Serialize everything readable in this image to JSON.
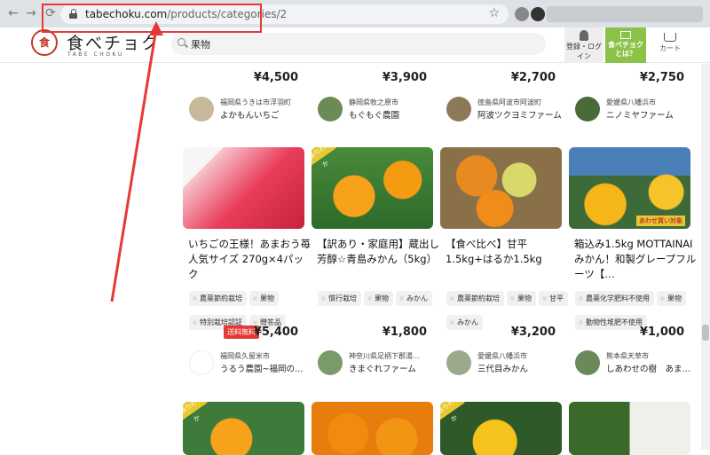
{
  "browser": {
    "url_domain": "tabechoku.com",
    "url_path": "/products/categories/2"
  },
  "header": {
    "logo_text": "食べチョク",
    "logo_sub": "TABE CHOKU",
    "search_value": "果物",
    "login_label": "登録・ログイン",
    "about_label": "食べチョクとは？",
    "cart_label": "カート"
  },
  "top_row": {
    "prices": [
      "¥4,500",
      "¥3,900",
      "¥2,700",
      "¥2,750"
    ],
    "farms": [
      {
        "location": "福岡県うきは市浮羽町",
        "name": "よかもんいちご"
      },
      {
        "location": "静岡県牧之原市",
        "name": "もぐもぐ農園"
      },
      {
        "location": "徳島県阿波市阿波町",
        "name": "阿波ツクヨミファーム"
      },
      {
        "location": "愛媛県八幡浜市",
        "name": "ニノミヤファーム"
      }
    ]
  },
  "products": [
    {
      "title": "いちごの王様！あまおう苺 人気サイズ 270g×4パック",
      "tags": [
        "農薬節約栽培",
        "果物",
        "特別栽培認証",
        "贈答品"
      ],
      "sale_badge": "送料無料",
      "price": "¥5,400",
      "farm_location": "福岡県久留米市",
      "farm_name": "うるう農園~福岡の…"
    },
    {
      "title": "【訳あり・家庭用】蔵出し芳醇☆青島みかん（5kg）",
      "tags": [
        "慣行栽培",
        "果物",
        "みかん"
      ],
      "price": "¥1,800",
      "farm_location": "神奈川県足柄下郡湯…",
      "farm_name": "きまぐれファーム",
      "ribbon": "訳ありわずか"
    },
    {
      "title": "【食べ比べ】甘平1.5kg+はるか1.5kg",
      "tags": [
        "農薬節約栽培",
        "果物",
        "甘平",
        "みかん"
      ],
      "price": "¥3,200",
      "farm_location": "愛媛県八幡浜市",
      "farm_name": "三代目みかん"
    },
    {
      "title": "箱込み1.5kg MOTTAINAIみかん！和製グレープフルーツ【…",
      "tags": [
        "農薬化学肥料不使用",
        "果物",
        "動物性堆肥不使用"
      ],
      "price": "¥1,000",
      "farm_location": "熊本県天草市",
      "farm_name": "しあわせの樹　あま…",
      "image_label": "あわせ買い対象"
    }
  ],
  "bottom_row_ribbon": "訳ありわずか",
  "colors": {
    "accent_green": "#8bc34a",
    "sale_red": "#e53935",
    "annotation_red": "#e53935"
  }
}
